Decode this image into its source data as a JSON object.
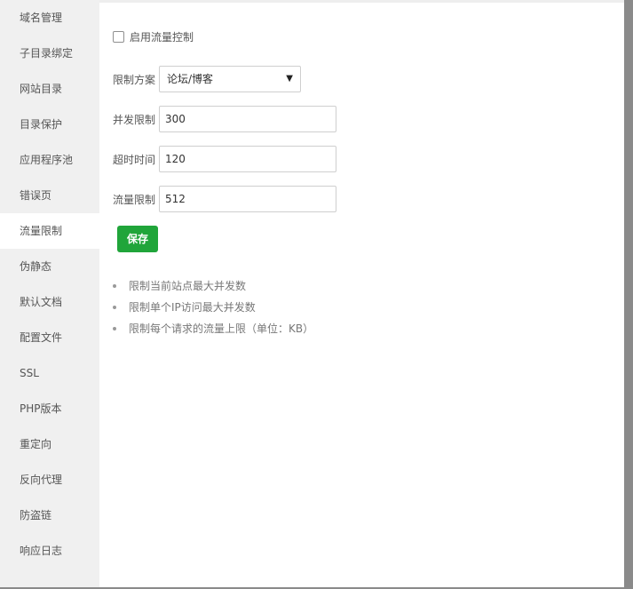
{
  "sidebar": {
    "items": [
      {
        "label": "域名管理"
      },
      {
        "label": "子目录绑定"
      },
      {
        "label": "网站目录"
      },
      {
        "label": "目录保护"
      },
      {
        "label": "应用程序池"
      },
      {
        "label": "错误页"
      },
      {
        "label": "流量限制",
        "active": true
      },
      {
        "label": "伪静态"
      },
      {
        "label": "默认文档"
      },
      {
        "label": "配置文件"
      },
      {
        "label": "SSL"
      },
      {
        "label": "PHP版本"
      },
      {
        "label": "重定向"
      },
      {
        "label": "反向代理"
      },
      {
        "label": "防盗链"
      },
      {
        "label": "响应日志"
      }
    ]
  },
  "form": {
    "enable_label": "启用流量控制",
    "enabled": false,
    "scheme_label": "限制方案",
    "scheme_value": "论坛/博客",
    "concurrent_label": "并发限制",
    "concurrent_value": "300",
    "timeout_label": "超时时间",
    "timeout_value": "120",
    "traffic_label": "流量限制",
    "traffic_value": "512",
    "save_label": "保存"
  },
  "tips": [
    "限制当前站点最大并发数",
    "限制单个IP访问最大并发数",
    "限制每个请求的流量上限（单位：KB）"
  ],
  "colors": {
    "accent": "#20a53a",
    "sidebar_bg": "#f0f0f0"
  }
}
